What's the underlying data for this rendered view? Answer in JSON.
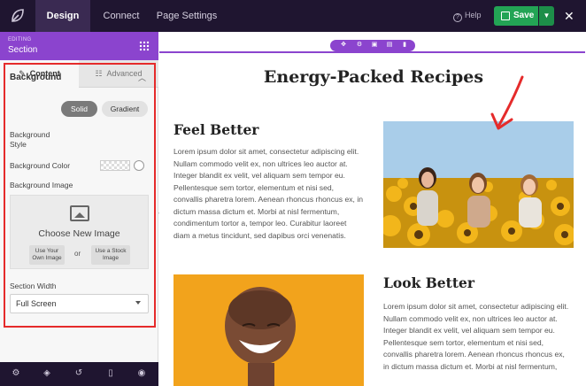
{
  "topbar": {
    "tabs": [
      {
        "label": "Design"
      },
      {
        "label": "Connect"
      },
      {
        "label": "Page Settings"
      }
    ],
    "help_label": "Help",
    "save_label": "Save"
  },
  "sidebar": {
    "editing_label": "EDITING",
    "section_title": "Section",
    "tabs": [
      {
        "label": "Content",
        "icon": "pencil-icon"
      },
      {
        "label": "Advanced",
        "icon": "sliders-icon"
      }
    ],
    "background": {
      "title": "Background",
      "style_label": "Background Style",
      "style_options": [
        "Solid",
        "Gradient"
      ],
      "style_selected": "Solid",
      "color_label": "Background Color",
      "image_label": "Background Image",
      "choose_title": "Choose New Image",
      "use_own": "Use Your Own Image",
      "or": "or",
      "use_stock": "Use a Stock Image"
    },
    "width": {
      "label": "Section Width",
      "value": "Full Screen"
    },
    "footer_icons": [
      "gear-icon",
      "layers-icon",
      "history-icon",
      "mobile-icon",
      "eye-icon"
    ]
  },
  "preview": {
    "page_title": "Energy-Packed Recipes",
    "col1_heading": "Feel Better",
    "col1_text": "Lorem ipsum dolor sit amet, consectetur adipiscing elit. Nullam commodo velit ex, non ultrices leo auctor at. Integer blandit ex velit, vel aliquam sem tempor eu. Pellentesque sem tortor, elementum et nisi sed, convallis pharetra lorem. Aenean rhoncus rhoncus ex, in dictum massa dictum et. Morbi at nisl fermentum, condimentum tortor a, tempor leo. Curabitur laoreet diam a metus tincidunt, sed dapibus orci venenatis.",
    "col2_heading": "Look Better",
    "col2_text": "Lorem ipsum dolor sit amet, consectetur adipiscing elit. Nullam commodo velit ex, non ultrices leo auctor at. Integer blandit ex velit, vel aliquam sem tempor eu. Pellentesque sem tortor, elementum et nisi sed, convallis pharetra lorem. Aenean rhoncus rhoncus ex, in dictum massa dictum et. Morbi at nisl fermentum,"
  },
  "colors": {
    "topbar_bg": "#1f1530",
    "accent_purple": "#8b44ce",
    "save_green": "#23a455",
    "annotation_red": "#e52b2b"
  }
}
